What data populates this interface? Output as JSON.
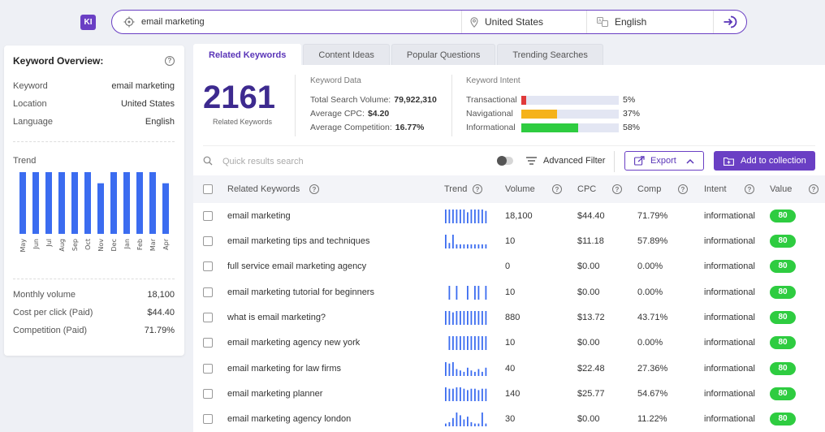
{
  "app": {
    "logo_text": "KI"
  },
  "search": {
    "keyword": "email marketing",
    "location": "United States",
    "language": "English"
  },
  "overview": {
    "title": "Keyword Overview:",
    "rows": [
      {
        "label": "Keyword",
        "value": "email marketing"
      },
      {
        "label": "Location",
        "value": "United States"
      },
      {
        "label": "Language",
        "value": "English"
      }
    ],
    "trend_label": "Trend",
    "trend": {
      "months": [
        "May",
        "Jun",
        "Jul",
        "Aug",
        "Sep",
        "Oct",
        "Nov",
        "Dec",
        "Jan",
        "Feb",
        "Mar",
        "Apr"
      ],
      "values": [
        100,
        100,
        100,
        100,
        100,
        100,
        82,
        100,
        100,
        100,
        100,
        82
      ],
      "bar_color": "#3b6cf0"
    },
    "stats": [
      {
        "label": "Monthly volume",
        "value": "18,100"
      },
      {
        "label": "Cost per click (Paid)",
        "value": "$44.40"
      },
      {
        "label": "Competition (Paid)",
        "value": "71.79%"
      }
    ]
  },
  "tabs": [
    {
      "label": "Related Keywords",
      "active": true
    },
    {
      "label": "Content Ideas",
      "active": false
    },
    {
      "label": "Popular Questions",
      "active": false
    },
    {
      "label": "Trending Searches",
      "active": false
    }
  ],
  "summary": {
    "count": "2161",
    "count_label": "Related Keywords",
    "data_title": "Keyword Data",
    "data_rows": [
      {
        "label": "Total Search Volume:",
        "value": "79,922,310"
      },
      {
        "label": "Average CPC:",
        "value": "$4.20"
      },
      {
        "label": "Average Competition:",
        "value": "16.77%"
      }
    ],
    "intent_title": "Keyword Intent",
    "intent_rows": [
      {
        "label": "Transactional",
        "value": "5%",
        "fraction": 0.05,
        "color": "#e03a3a"
      },
      {
        "label": "Navigational",
        "value": "37%",
        "fraction": 0.37,
        "color": "#f5b21a"
      },
      {
        "label": "Informational",
        "value": "58%",
        "fraction": 0.58,
        "color": "#2ecc40"
      }
    ]
  },
  "toolbar": {
    "search_placeholder": "Quick results search",
    "filter_label": "Advanced Filter",
    "export_label": "Export",
    "collection_label": "Add to collection"
  },
  "table": {
    "headers": [
      "Related Keywords",
      "Trend",
      "Volume",
      "CPC",
      "Comp",
      "Intent",
      "Value"
    ],
    "rows": [
      {
        "keyword": "email marketing",
        "trend": [
          10,
          10,
          10,
          10,
          10,
          10,
          8,
          10,
          10,
          10,
          10,
          9
        ],
        "volume": "18,100",
        "cpc": "$44.40",
        "comp": "71.79%",
        "intent": "informational",
        "value": "80"
      },
      {
        "keyword": "email marketing tips and techniques",
        "trend": [
          10,
          4,
          10,
          3,
          3,
          3,
          3,
          3,
          3,
          3,
          3,
          3
        ],
        "volume": "10",
        "cpc": "$11.18",
        "comp": "57.89%",
        "intent": "informational",
        "value": "80"
      },
      {
        "keyword": "full service email marketing agency",
        "trend": [
          0,
          0,
          0,
          0,
          0,
          0,
          0,
          0,
          0,
          0,
          0,
          0
        ],
        "volume": "0",
        "cpc": "$0.00",
        "comp": "0.00%",
        "intent": "informational",
        "value": "80"
      },
      {
        "keyword": "email marketing tutorial for beginners",
        "trend": [
          0,
          10,
          0,
          10,
          0,
          0,
          10,
          0,
          10,
          10,
          0,
          10
        ],
        "volume": "10",
        "cpc": "$0.00",
        "comp": "0.00%",
        "intent": "informational",
        "value": "80"
      },
      {
        "keyword": "what is email marketing?",
        "trend": [
          10,
          10,
          9,
          10,
          10,
          10,
          10,
          10,
          10,
          10,
          10,
          10
        ],
        "volume": "880",
        "cpc": "$13.72",
        "comp": "43.71%",
        "intent": "informational",
        "value": "80"
      },
      {
        "keyword": "email marketing agency new york",
        "trend": [
          0,
          10,
          10,
          10,
          10,
          10,
          10,
          10,
          10,
          10,
          10,
          10
        ],
        "volume": "10",
        "cpc": "$0.00",
        "comp": "0.00%",
        "intent": "informational",
        "value": "80"
      },
      {
        "keyword": "email marketing for law firms",
        "trend": [
          10,
          9,
          10,
          5,
          4,
          3,
          6,
          4,
          3,
          5,
          3,
          6
        ],
        "volume": "40",
        "cpc": "$22.48",
        "comp": "27.36%",
        "intent": "informational",
        "value": "80"
      },
      {
        "keyword": "email marketing planner",
        "trend": [
          10,
          9,
          9,
          10,
          10,
          9,
          8,
          9,
          9,
          8,
          9,
          9
        ],
        "volume": "140",
        "cpc": "$25.77",
        "comp": "54.67%",
        "intent": "informational",
        "value": "80"
      },
      {
        "keyword": "email marketing agency london",
        "trend": [
          2,
          3,
          6,
          10,
          8,
          5,
          7,
          3,
          2,
          2,
          10,
          2
        ],
        "volume": "30",
        "cpc": "$0.00",
        "comp": "11.22%",
        "intent": "informational",
        "value": "80"
      }
    ]
  },
  "colors": {
    "accent": "#6a3fc4",
    "value_badge": "#2ecc40",
    "sparkline": "#3b6cf0"
  }
}
